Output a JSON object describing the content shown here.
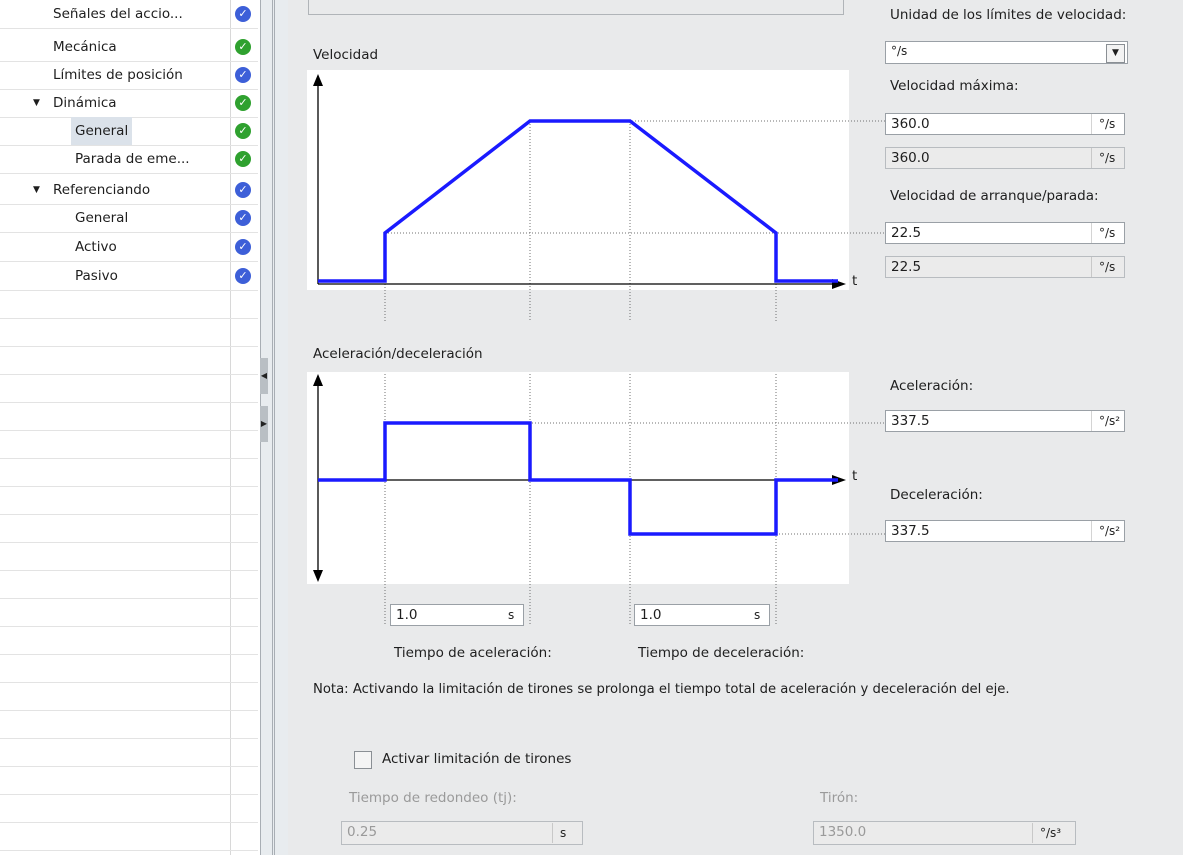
{
  "tree": {
    "items": [
      {
        "label": "Señales del accio...",
        "status": "blue"
      },
      {
        "label": "Mecánica",
        "status": "green"
      },
      {
        "label": "Límites de posición",
        "status": "blue"
      },
      {
        "label": "Dinámica",
        "status": "green"
      },
      {
        "label": "General",
        "status": "green"
      },
      {
        "label": "Parada de eme...",
        "status": "green"
      },
      {
        "label": "Referenciando",
        "status": "blue"
      },
      {
        "label": "General",
        "status": "blue"
      },
      {
        "label": "Activo",
        "status": "blue"
      },
      {
        "label": "Pasivo",
        "status": "blue"
      }
    ]
  },
  "velocity_chart": {
    "title": "Velocidad",
    "t_label": "t"
  },
  "accel_chart": {
    "title": "Aceleración/deceleración",
    "t_label": "t"
  },
  "speed_unit": {
    "label": "Unidad de los límites de velocidad:",
    "value": "°/s"
  },
  "max_velocity": {
    "label": "Velocidad máxima:",
    "value": "360.0",
    "value_ro": "360.0",
    "unit": "°/s"
  },
  "start_stop_velocity": {
    "label": "Velocidad de arranque/parada:",
    "value": "22.5",
    "value_ro": "22.5",
    "unit": "°/s"
  },
  "acceleration": {
    "label": "Aceleración:",
    "value": "337.5",
    "unit": "°/s²"
  },
  "deceleration": {
    "label": "Deceleración:",
    "value": "337.5",
    "unit": "°/s²"
  },
  "accel_time": {
    "label": "Tiempo de aceleración:",
    "value": "1.0",
    "unit": "s"
  },
  "decel_time": {
    "label": "Tiempo de deceleración:",
    "value": "1.0",
    "unit": "s"
  },
  "note": "Nota: Activando la limitación de tirones se prolonga el tiempo total de aceleración y deceleración del eje.",
  "jerk": {
    "checkbox_label": "Activar limitación de tirones",
    "checked": false,
    "rounding_label": "Tiempo de redondeo (tj):",
    "rounding_value": "0.25",
    "rounding_unit": "s",
    "jerk_label": "Tirón:",
    "jerk_value": "1350.0",
    "jerk_unit": "°/s³"
  },
  "colors": {
    "curve": "#1a1aff",
    "ok": "#2fa12f",
    "info": "#3d5fd8"
  }
}
